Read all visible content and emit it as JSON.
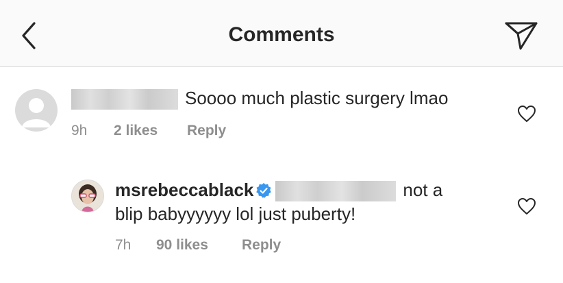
{
  "header": {
    "title": "Comments"
  },
  "comments": [
    {
      "text": "Soooo much plastic surgery lmao",
      "time": "9h",
      "likes": "2 likes",
      "reply_label": "Reply"
    },
    {
      "username": "msrebeccablack",
      "text_line1": "not a",
      "text_line2": "blip babyyyyyy lol just puberty!",
      "time": "7h",
      "likes": "90 likes",
      "reply_label": "Reply"
    }
  ],
  "colors": {
    "text": "#262626",
    "meta": "#8e8e8e",
    "verified": "#3897f0",
    "header_bg": "#fafafa"
  }
}
